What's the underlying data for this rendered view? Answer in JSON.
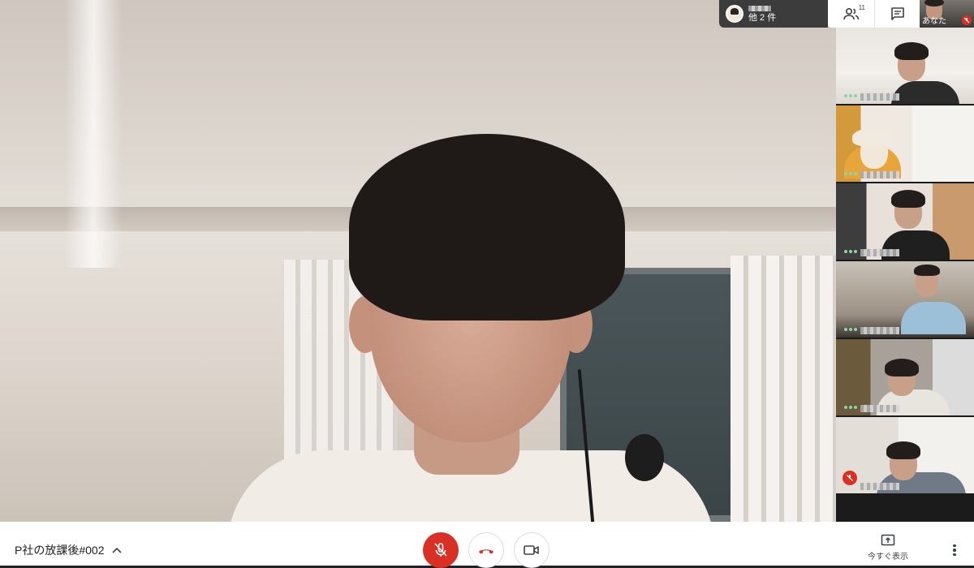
{
  "header": {
    "participant_chip": {
      "label": "他 2 件"
    },
    "people_count": "11",
    "self_label": "あなた"
  },
  "main_video": {
    "speaker": "main-participant"
  },
  "side_tiles": [
    {
      "status": "speaking"
    },
    {
      "status": "speaking"
    },
    {
      "status": "speaking"
    },
    {
      "status": "speaking"
    },
    {
      "status": "speaking"
    },
    {
      "status": "muted"
    }
  ],
  "bottom_bar": {
    "meeting_title": "P社の放課後#002",
    "present_label": "今すぐ表示"
  },
  "colors": {
    "mute_red": "#d93025",
    "hangup_red": "#d93025",
    "speaking_dots": "#8ed4a8"
  },
  "icons": [
    "people-icon",
    "chat-icon",
    "mic-off-icon",
    "hang-up-icon",
    "camera-icon",
    "present-icon",
    "more-vert-icon",
    "chevron-up-icon"
  ]
}
